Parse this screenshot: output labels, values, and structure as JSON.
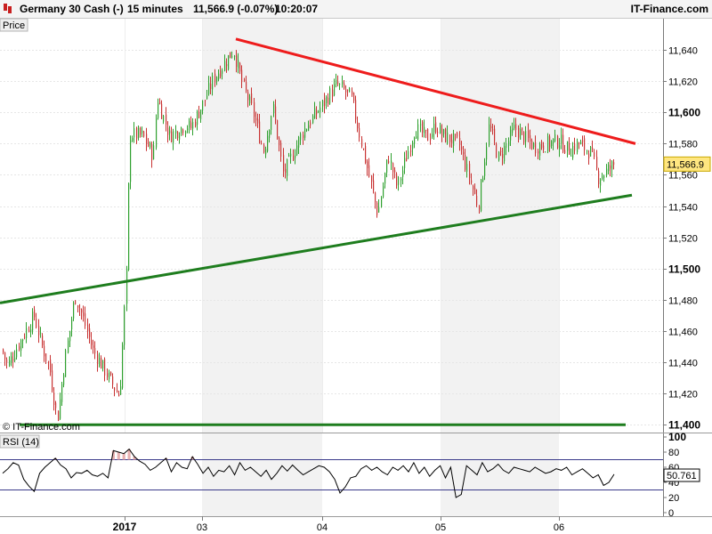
{
  "header": {
    "instrument": "Germany 30 Cash (-)",
    "timeframe": "15 minutes",
    "quote": "11,566.9 (-0.07%)",
    "time": "10:20:07",
    "brand": "IT-Finance.com"
  },
  "price_panel": {
    "tab_label": "Price",
    "watermark": "© IT-Finance.com",
    "last_price_label": "11,566.9"
  },
  "rsi_panel": {
    "label": "RSI (14)",
    "value_label": "50.761"
  },
  "colors": {
    "candle_up": "#2fa02f",
    "candle_down": "#c83232",
    "resistance_line": "#ee1c1c",
    "support_line": "#1e7d1e",
    "band_shade": "#f2f2f2",
    "rsi_line": "#000000",
    "rsi_fill": "#e8b0b0",
    "last_price_badge": "#ffe680"
  },
  "chart_data": [
    {
      "type": "candlestick",
      "ylim": [
        11395,
        11660
      ],
      "x_ticks": [
        "2017",
        "03",
        "04",
        "05",
        "06"
      ],
      "y_ticks": [
        "11,420",
        "11,440",
        "11,460",
        "11,480",
        "11,500",
        "11,520",
        "11,540",
        "11,560",
        "11,580",
        "11,600",
        "11,620",
        "11,640"
      ],
      "y_ticks_bold": [
        "11,400",
        "11,500",
        "11,600"
      ],
      "y_tick_values": [
        11400,
        11420,
        11440,
        11460,
        11480,
        11500,
        11520,
        11540,
        11560,
        11580,
        11600,
        11620,
        11640
      ],
      "shaded_days": [
        "03",
        "05"
      ],
      "last_price": 11566.9,
      "anchors": [
        {
          "x": "start",
          "y": 11448
        },
        {
          "x": "start+",
          "y": 11438
        },
        {
          "x": "a1",
          "y": 11470
        },
        {
          "x": "a2",
          "y": 11452
        },
        {
          "x": "a3",
          "y": 11437
        },
        {
          "x": "a4",
          "y": 11403
        },
        {
          "x": "a5",
          "y": 11440
        },
        {
          "x": "a6",
          "y": 11482
        },
        {
          "x": "a7",
          "y": 11470
        },
        {
          "x": "a8",
          "y": 11448
        },
        {
          "x": "a9",
          "y": 11418
        },
        {
          "x": "a10",
          "y": 11500
        },
        {
          "x": "2017",
          "y": 11586
        },
        {
          "x": "b1",
          "y": 11585
        },
        {
          "x": "b2",
          "y": 11572
        },
        {
          "x": "b3",
          "y": 11610
        },
        {
          "x": "b4",
          "y": 11585
        },
        {
          "x": "b5",
          "y": 11592
        },
        {
          "x": "b6",
          "y": 11590
        },
        {
          "x": "03",
          "y": 11605
        },
        {
          "x": "c1",
          "y": 11622
        },
        {
          "x": "c2",
          "y": 11640
        },
        {
          "x": "c3",
          "y": 11618
        },
        {
          "x": "c4",
          "y": 11600
        },
        {
          "x": "c5",
          "y": 11575
        },
        {
          "x": "c6",
          "y": 11604
        },
        {
          "x": "c7",
          "y": 11560
        },
        {
          "x": "c8",
          "y": 11588
        },
        {
          "x": "04",
          "y": 11605
        },
        {
          "x": "d1",
          "y": 11618
        },
        {
          "x": "d2",
          "y": 11610
        },
        {
          "x": "d3",
          "y": 11570
        },
        {
          "x": "d4",
          "y": 11535
        },
        {
          "x": "d5",
          "y": 11572
        },
        {
          "x": "d6",
          "y": 11552
        },
        {
          "x": "d7",
          "y": 11590
        },
        {
          "x": "d8",
          "y": 11584
        },
        {
          "x": "d9",
          "y": 11592
        },
        {
          "x": "05",
          "y": 11586
        },
        {
          "x": "e1",
          "y": 11580
        },
        {
          "x": "e2",
          "y": 11540
        },
        {
          "x": "e3",
          "y": 11592
        },
        {
          "x": "e4",
          "y": 11570
        },
        {
          "x": "e5",
          "y": 11590
        },
        {
          "x": "e6",
          "y": 11578
        },
        {
          "x": "06",
          "y": 11582
        },
        {
          "x": "f1",
          "y": 11576
        },
        {
          "x": "f2",
          "y": 11580
        },
        {
          "x": "f3",
          "y": 11574
        },
        {
          "x": "f4",
          "y": 11558
        },
        {
          "x": "f5",
          "y": 11562
        },
        {
          "x": "last",
          "y": 11566.9
        }
      ],
      "resistance_line": {
        "from": 11647,
        "to": 11580
      },
      "support_line": {
        "from": 11478,
        "to": 11547
      },
      "horizontal_support": 11400
    },
    {
      "type": "line",
      "name": "RSI (14)",
      "ylim": [
        0,
        100
      ],
      "y_ticks": [
        "100",
        "80",
        "60",
        "40",
        "20",
        "0"
      ],
      "y_tick_values": [
        100,
        80,
        60,
        40,
        20,
        0
      ],
      "overbought": 70,
      "oversold": 30,
      "last_value": 50.761,
      "values": [
        52,
        58,
        66,
        63,
        44,
        35,
        28,
        52,
        60,
        66,
        72,
        63,
        58,
        46,
        53,
        52,
        56,
        50,
        48,
        52,
        46,
        82,
        80,
        78,
        84,
        74,
        68,
        64,
        56,
        60,
        66,
        72,
        54,
        66,
        60,
        58,
        74,
        64,
        52,
        60,
        48,
        56,
        54,
        62,
        50,
        66,
        56,
        60,
        54,
        48,
        56,
        44,
        52,
        62,
        55,
        63,
        56,
        50,
        54,
        58,
        62,
        60,
        54,
        44,
        26,
        34,
        46,
        48,
        58,
        62,
        56,
        60,
        54,
        50,
        60,
        56,
        62,
        54,
        66,
        52,
        60,
        48,
        56,
        62,
        46,
        60,
        20,
        24,
        62,
        56,
        50,
        66,
        54,
        58,
        64,
        56,
        52,
        60,
        58,
        56,
        54,
        60,
        56,
        52,
        54,
        58,
        56,
        60,
        50,
        54,
        58,
        52,
        46,
        50,
        36,
        40,
        50.761
      ]
    }
  ]
}
